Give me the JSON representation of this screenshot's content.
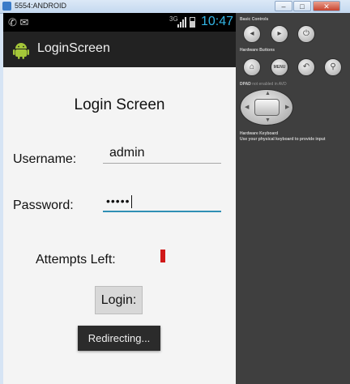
{
  "window": {
    "title": "5554:ANDROID",
    "minimize": "–",
    "maximize": "□",
    "close": "✕"
  },
  "statusbar": {
    "notifications": "✆ ✉",
    "network": "3G",
    "time": "10:47"
  },
  "app": {
    "title": "LoginScreen",
    "icon": "android-robot-icon"
  },
  "login": {
    "screen_title": "Login Screen",
    "username_label": "Username:",
    "username_value": "admin",
    "password_label": "Password:",
    "password_value": "•••••",
    "attempts_label": "Attempts Left:",
    "attempts_indicator_color": "#d01818",
    "login_button": "Login:",
    "toast": "Redirecting..."
  },
  "panel": {
    "basic_controls": "Basic Controls",
    "hardware_buttons": "Hardware Buttons",
    "dpad_label": "DPAD",
    "dpad_note": "not enabled in AVD",
    "keyboard_label": "Hardware Keyboard",
    "keyboard_note": "Use your physical keyboard to provide input",
    "menu_button": "MENU",
    "icons": [
      "volume-down-icon",
      "volume-up-icon",
      "power-icon",
      "home-icon",
      "back-icon",
      "search-icon"
    ]
  },
  "colors": {
    "accent": "#33b5e5",
    "focus_underline": "#2f8fb5",
    "panel_bg": "#3f3f3f",
    "actionbar_bg": "#222222"
  }
}
